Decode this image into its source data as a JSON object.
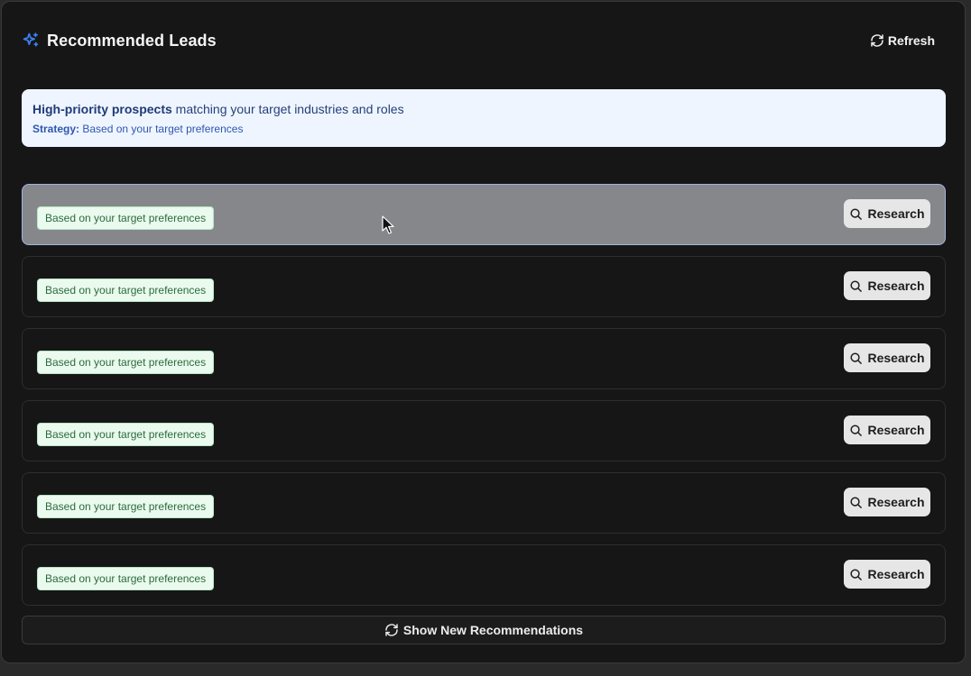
{
  "header": {
    "title": "Recommended Leads",
    "refresh_label": "Refresh",
    "icon": "sparkles-icon",
    "icon_color": "#3b82f6"
  },
  "info": {
    "highlight": "High-priority prospects",
    "rest": " matching your target industries and roles",
    "strategy_label": "Strategy:",
    "strategy_value": " Based on your target preferences"
  },
  "leads": [
    {
      "tag": "Based on your target preferences",
      "button": "Research",
      "hovered": true
    },
    {
      "tag": "Based on your target preferences",
      "button": "Research",
      "hovered": false
    },
    {
      "tag": "Based on your target preferences",
      "button": "Research",
      "hovered": false
    },
    {
      "tag": "Based on your target preferences",
      "button": "Research",
      "hovered": false
    },
    {
      "tag": "Based on your target preferences",
      "button": "Research",
      "hovered": false
    },
    {
      "tag": "Based on your target preferences",
      "button": "Research",
      "hovered": false
    }
  ],
  "footer": {
    "show_new_label": "Show New Recommendations"
  }
}
